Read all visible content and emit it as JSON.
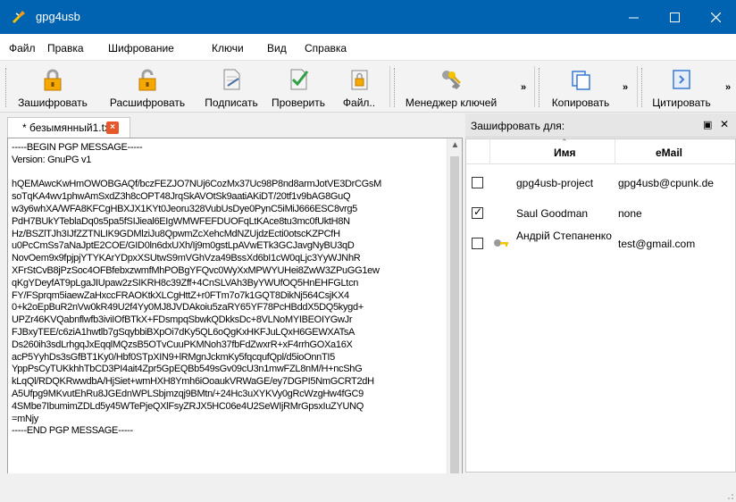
{
  "window": {
    "title": "gpg4usb"
  },
  "menu": [
    "Файл",
    "Правка",
    "Шифрование",
    "Ключи",
    "Вид",
    "Справка"
  ],
  "toolbar": {
    "encrypt": "Зашифровать",
    "decrypt": "Расшифровать",
    "sign": "Подписать",
    "verify": "Проверить",
    "file": "Файл..",
    "keymgr": "Менеджер ключей",
    "copy": "Копировать",
    "quote": "Цитировать",
    "more": "»"
  },
  "tab": {
    "label": "* безымянный1.txt",
    "close": "×"
  },
  "editor": {
    "text": "-----BEGIN PGP MESSAGE-----\nVersion: GnuPG v1\n\nhQEMAwcKwHmOWOBGAQf/bczFEZJO7NUj6CozMx37Uc98P8nd8armJotVE3DrCGsM\nsoTqKA4wv1phwAmSxdZ3h8cOPT48JrqSkAVOtSk9aatiAKiDT/20tf1v9bAG8GuQ\nw3y6whXA/WFA8KFCgHBXJX1KYt0Jeoru328VubUsDye0PynC5iMiJ666ESC8vrg5\nPdH7BUkYTeblaDq0s5pa5fSIJieal6EIgWMWFEFDUOFqLtKAce8tu3mc0fUktH8N\nHz/BSZlTJh3IJfZZTNLIK9GDMlziJu8QpwmZcXehcMdNZUjdzEcti0otscKZPCfH\nu0PcCmSs7aNaJptE2COE/GID0ln6dxUXh/Ij9m0gstLpAVwETk3GCJavgNyBU3qD\nNovOem9x9fpjpjYTYKArYDpxXSUtwS9mVGhVza49BssXd6bI1cW0qLjc3YyWJNhR\nXFrStCvB8jPzSoc4OFBfebxzwmfMhPOBgYFQvc0WyXxMPWYUHei8ZwW3ZPuGG1ew\nqKgYDeyfAT9pLgaJIUpaw2zSIKRH8c39Zff+4CnSLVAh3ByYWUfOQ5HnEHFGLtcn\nFY/FSprqm5iaewZaHxccFRAOKtkXLCgHttZ+r0FTm7o7k1GQT8DikNj564CsjKX4\n0+k2oEpBuR2nVw0kR49U2f4Yy0MJ8JVDAkoiu5zaRY65YF78PcHBddX5DQ5kygd+\nUPZr46KVQabnflwfb3iviIOfBTkX+FDsmpqSbwkQDkksDc+8VLNoMYIBEOIYGwJr\nFJBxyTEE/c6ziA1hwtlb7gSqybbiBXpOi7dKy5QL6oQgKxHKFJuLQxH6GEWXATsA\nDs260ih3sdLrhgqJxEqqlMQzsB5OTvCuuPKMNoh37fbFdZwxrR+xF4rrhGOXa16X\nacP5YyhDs3sGfBT1Ky0/Hbf0STpXIN9+lRMgnJckmKy5fqcqufQpl/d5ioOnnTI5\nYppPsCyTUKkhhTbCD3PI4ait4Zpr5GpEQBb549sGv09cU3n1mwFZL8nM/H+ncShG\nkLqQl/RDQKRwwdbA/HjSiet+wmHXH8Ymh6iOoaukVRWaGE/ey7DGPI5NmGCRT2dH\nA5Ufpg9MKvutEhRu8JGEdnWPLSbjmzqj9BMtn/+24Hc3uXYKVy0gRcWzgHw4fGC9\n4SMbe7IbumimZDLd5y45WTePjeQXlFsyZRJX5HC06e4U2SeWIjRMrGpsxIuZYUNQ\n=mNjy\n-----END PGP MESSAGE-----"
  },
  "recipients": {
    "title": "Зашифровать для:",
    "col_name": "Имя",
    "col_email": "eMail",
    "rows": [
      {
        "name": "gpg4usb-project",
        "email": "gpg4usb@cpunk.de",
        "checked": false
      },
      {
        "name": "Saul Goodman",
        "email": "none",
        "checked": true
      },
      {
        "name": "Андрій Степаненко",
        "email": "test@gmail.com",
        "checked": false
      }
    ]
  }
}
